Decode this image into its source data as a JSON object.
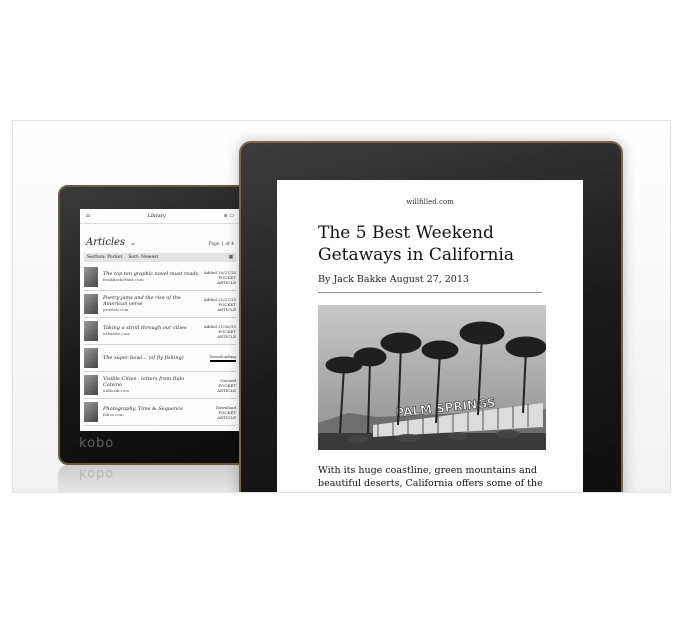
{
  "back_device": {
    "brand": "kobo",
    "library": {
      "status_title": "Library",
      "title": "Articles",
      "page": "Page 1 of 4",
      "filter_section": "Section: Pocket",
      "filter_sort": "Sort: Newest",
      "items": [
        {
          "title": "The top ten graphic novel must reads",
          "source": "bookbackethist.com",
          "status": "Added 20/27/15",
          "type": "POCKET ARTICLE"
        },
        {
          "title": "Poetry jams and the rise of the American verse",
          "source": "proetch.com",
          "status": "Added 21/27/15",
          "type": "POCKET ARTICLE"
        },
        {
          "title": "Taking a stroll through our cities",
          "source": "urbanite.com",
          "status": "Added 21/26/15",
          "type": "POCKET ARTICLE"
        },
        {
          "title": "The super bowl... (of fly fishing)",
          "source": "",
          "status": "Downloading",
          "type": ""
        },
        {
          "title": "Visible Cities - letters from Italo Calvino",
          "source": "italbook.com",
          "status": "Queued",
          "type": "POCKET ARTICLE"
        },
        {
          "title": "Photography, Time & Sequence",
          "source": "folios.com",
          "status": "Download",
          "type": "POCKET ARTICLE"
        }
      ]
    }
  },
  "front_device": {
    "article": {
      "site": "willfilled.com",
      "headline": "The 5 Best Weekend Getaways in California",
      "byline": "By Jack Bakke   August 27, 2013",
      "photo_sign": "PALM SPRINGS",
      "body": "With its huge coastline, green mountains and beautiful deserts, California offers some of the best weekend getaways, and you don't even have to leave the state. Nearly"
    }
  }
}
